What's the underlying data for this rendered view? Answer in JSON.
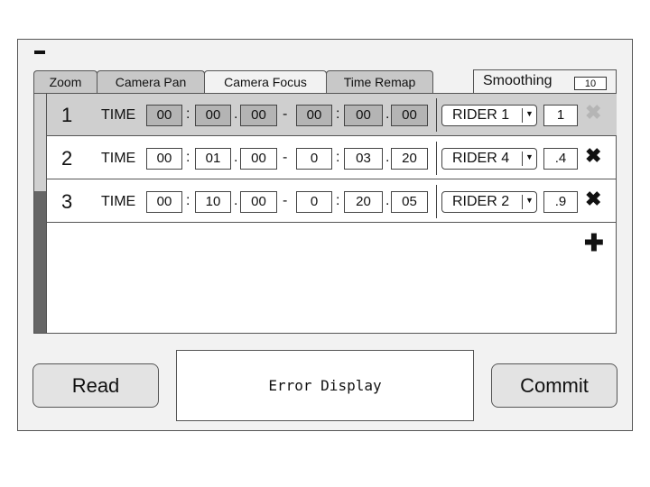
{
  "tabs": [
    {
      "label": "Zoom"
    },
    {
      "label": "Camera Pan"
    },
    {
      "label": "Camera Focus"
    },
    {
      "label": "Time Remap"
    }
  ],
  "active_tab": "Camera Focus",
  "smoothing": {
    "label": "Smoothing",
    "value": "10"
  },
  "rows": [
    {
      "num": "1",
      "time_label": "TIME",
      "start": [
        "00",
        "00",
        "00"
      ],
      "end": [
        "00",
        "00",
        "00"
      ],
      "rider": "RIDER 1",
      "smoothing": "1",
      "selected": true,
      "delete_disabled": true
    },
    {
      "num": "2",
      "time_label": "TIME",
      "start": [
        "00",
        "01",
        "00"
      ],
      "end": [
        "0",
        "03",
        "20"
      ],
      "rider": "RIDER 4",
      "smoothing": ".4",
      "selected": false,
      "delete_disabled": false
    },
    {
      "num": "3",
      "time_label": "TIME",
      "start": [
        "00",
        "10",
        "00"
      ],
      "end": [
        "0",
        "20",
        "05"
      ],
      "rider": "RIDER 2",
      "smoothing": ".9",
      "selected": false,
      "delete_disabled": false
    }
  ],
  "read_button": "Read",
  "error_display": "Error Display",
  "commit_button": "Commit",
  "icons": {
    "minimize": "minus-icon",
    "delete": "cross-icon",
    "add": "plus-icon",
    "dropdown": "caret-down-icon"
  }
}
